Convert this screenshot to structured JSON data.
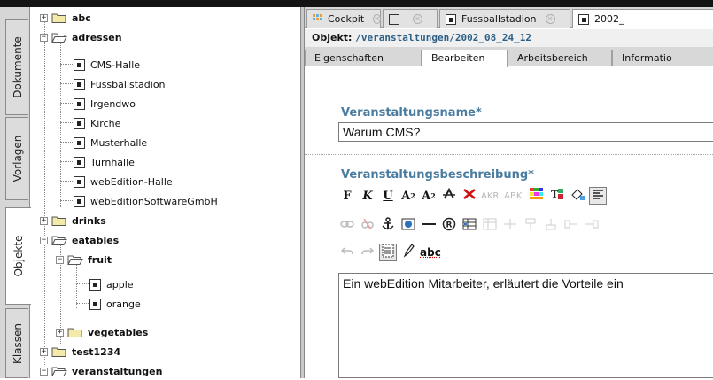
{
  "side_tabs": [
    {
      "label": "Dokumente"
    },
    {
      "label": "Vorlagen"
    },
    {
      "label": "Objekte"
    },
    {
      "label": "Klassen"
    }
  ],
  "tree": {
    "items": [
      {
        "label": "abc",
        "type": "folder",
        "expanded": false
      },
      {
        "label": "adressen",
        "type": "folder",
        "expanded": true
      },
      {
        "label": "CMS-Halle",
        "type": "object"
      },
      {
        "label": "Fussballstadion",
        "type": "object"
      },
      {
        "label": "Irgendwo",
        "type": "object"
      },
      {
        "label": "Kirche",
        "type": "object"
      },
      {
        "label": "Musterhalle",
        "type": "object"
      },
      {
        "label": "Turnhalle",
        "type": "object"
      },
      {
        "label": "webEdition-Halle",
        "type": "object"
      },
      {
        "label": "webEditionSoftwareGmbH",
        "type": "object"
      },
      {
        "label": "drinks",
        "type": "folder",
        "expanded": false
      },
      {
        "label": "eatables",
        "type": "folder",
        "expanded": true
      },
      {
        "label": "fruit",
        "type": "folder",
        "expanded": true
      },
      {
        "label": "apple",
        "type": "object"
      },
      {
        "label": "orange",
        "type": "object"
      },
      {
        "label": "vegetables",
        "type": "folder",
        "expanded": false
      },
      {
        "label": "test1234",
        "type": "folder",
        "expanded": false
      },
      {
        "label": "veranstaltungen",
        "type": "folder",
        "expanded": true
      }
    ]
  },
  "doc_tabs": [
    {
      "label": "Cockpit",
      "icon": "cockpit-icon"
    },
    {
      "label": "",
      "icon": "document-icon"
    },
    {
      "label": "Fussballstadion",
      "icon": "object-icon"
    },
    {
      "label": "2002_",
      "icon": "object-icon"
    }
  ],
  "object_line": {
    "prefix": "Objekt:",
    "path": "/veranstaltungen/2002_08_24_12"
  },
  "sub_tabs": [
    {
      "label": "Eigenschaften"
    },
    {
      "label": "Bearbeiten"
    },
    {
      "label": "Arbeitsbereich"
    },
    {
      "label": "Informatio"
    }
  ],
  "fields": {
    "name_label": "Veranstaltungsname*",
    "name_value": "Warum CMS?",
    "desc_label": "Veranstaltungsbeschreibung*",
    "desc_value": "Ein webEdition Mitarbeiter, erläutert die Vorteile ein"
  },
  "toolbar": {
    "row1": [
      "F",
      "K",
      "U",
      "A₂",
      "A²",
      "strikethrough-icon",
      "remove-format-icon",
      "AKR.",
      "ABK.",
      "color-icon",
      "text-color-icon",
      "bg-color-icon",
      "align-left-icon"
    ],
    "row1_text": {
      "bold": "F",
      "italic": "K",
      "underline": "U",
      "sub": "A",
      "sub_digit": "2",
      "sup": "A",
      "sup_digit": "2",
      "akr": "AKR.",
      "abk": "ABK."
    },
    "row3_spell": "abc"
  },
  "colors": {
    "label_blue": "#4a7ca0",
    "path_blue": "#2b5f85",
    "folder_yellow": "#f3e9a8",
    "panel_gray": "#d6d6d6"
  }
}
